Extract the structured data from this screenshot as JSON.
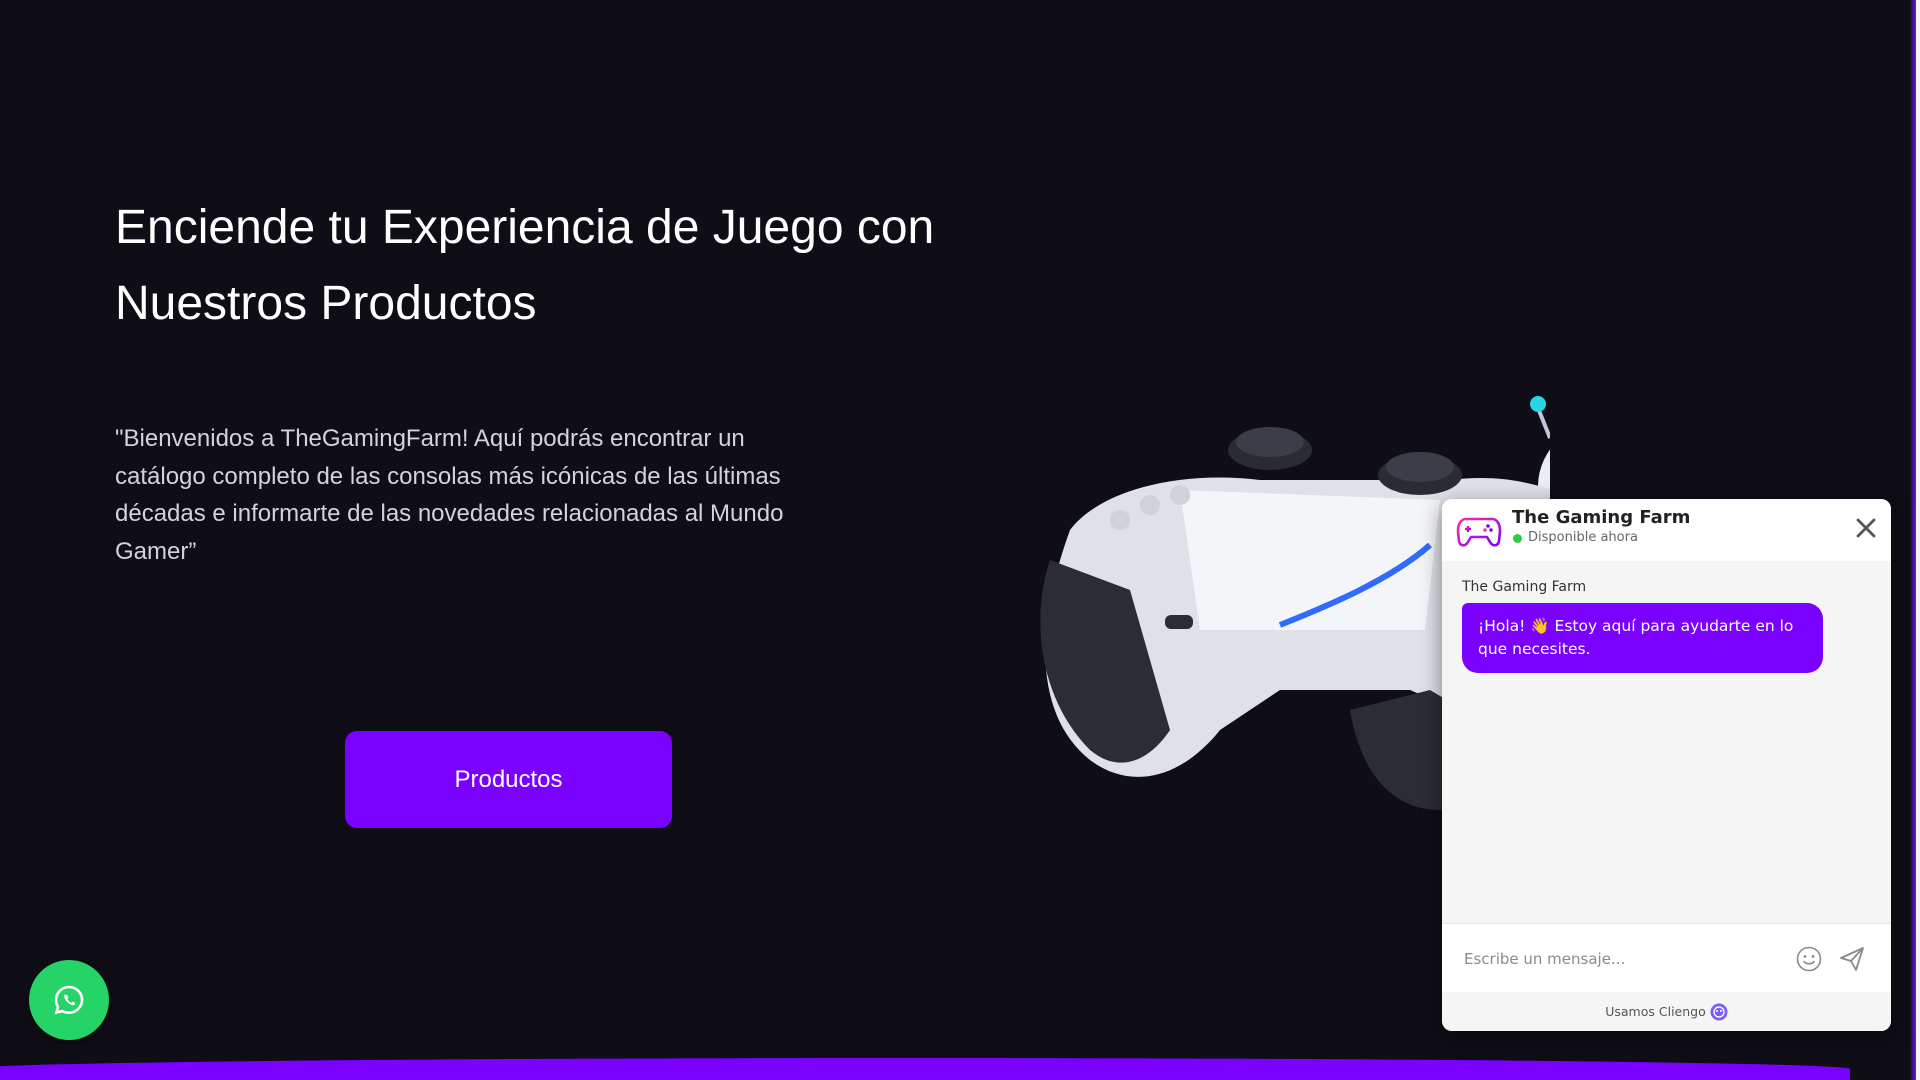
{
  "hero": {
    "title": "Enciende tu Experiencia de Juego con Nuestros Productos",
    "description": "\"Bienvenidos a TheGamingFarm! Aquí podrás encontrar un catálogo completo de las consolas más icónicas de las últimas décadas e informarte de las novedades relacionadas al Mundo Gamer”",
    "cta_label": "Productos"
  },
  "chat": {
    "brand_name": "The Gaming Farm",
    "status": "Disponible ahora",
    "sender": "The Gaming Farm",
    "greeting": "¡Hola! 👋 Estoy aquí para ayudarte en lo que necesites.",
    "input_placeholder": "Escribe un mensaje...",
    "footer_text": "Usamos Cliengo"
  },
  "icons": {
    "whatsapp": "whatsapp-icon",
    "close": "close-icon",
    "emoji": "emoji-icon",
    "send": "send-icon",
    "chat_logo": "gamepad-logo-icon",
    "footer_logo": "cliengo-logo-icon"
  },
  "colors": {
    "background": "#0f0e17",
    "accent": "#7a00ff",
    "whatsapp": "#25d366",
    "status_online": "#2ecc40"
  }
}
